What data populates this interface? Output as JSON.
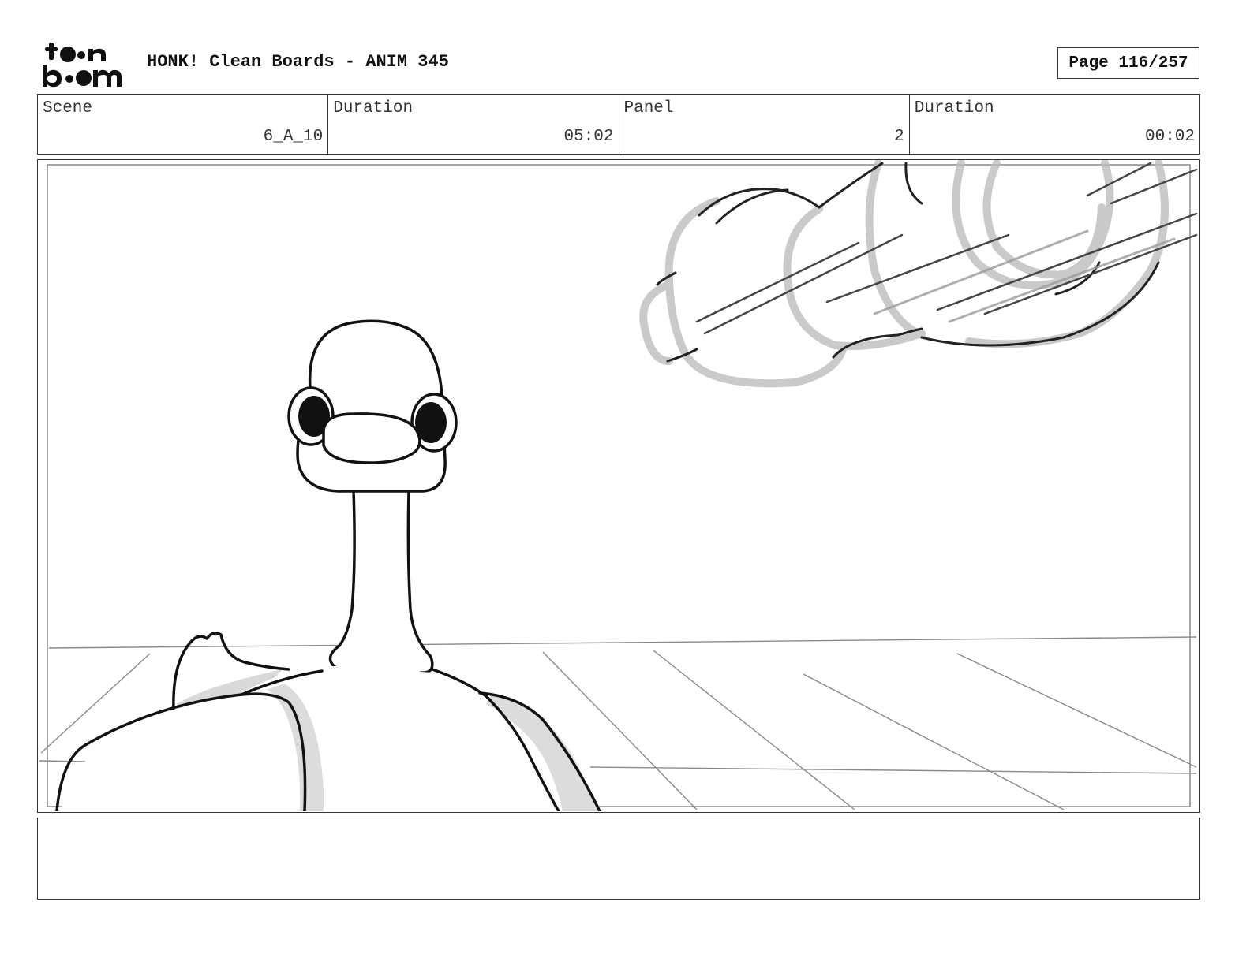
{
  "header": {
    "logo_text": "toon boom",
    "title": "HONK! Clean Boards - ANIM 345",
    "page": "Page 116/257"
  },
  "info": {
    "scene_label": "Scene",
    "scene_value": "6_A_10",
    "duration_label": "Duration",
    "duration_value": "05:02",
    "panel_label": "Panel",
    "panel_value": "2",
    "panel_duration_label": "Duration",
    "panel_duration_value": "00:02"
  },
  "notes": {
    "text": ""
  },
  "colors": {
    "frame_border": "#333333",
    "ink": "#111111",
    "shade": "#d6d6d6"
  }
}
